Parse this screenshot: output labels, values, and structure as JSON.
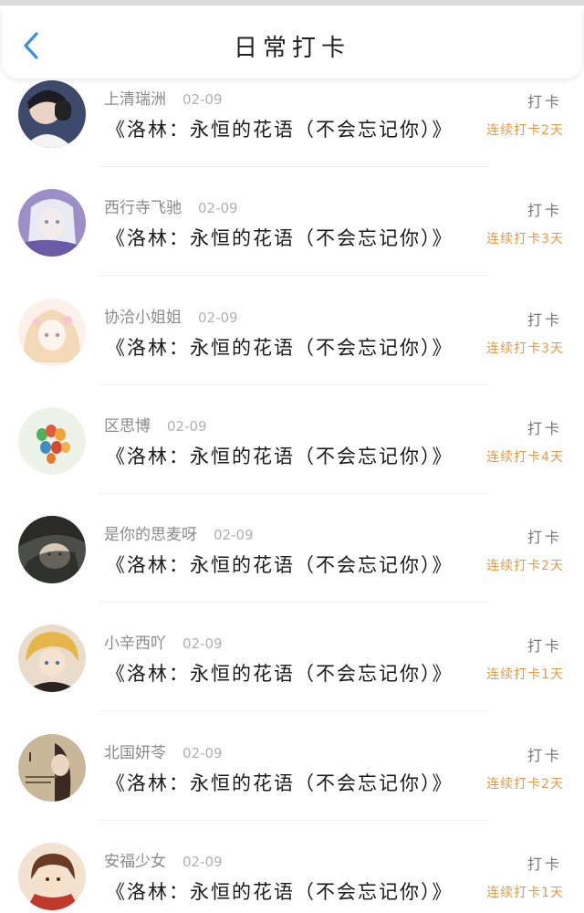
{
  "header": {
    "title": "日常打卡",
    "back_icon": "chevron-left-icon",
    "accent": "#3a8ee6"
  },
  "colors": {
    "streak": "#e29a4a",
    "meta": "#8a8a8a"
  },
  "entries": [
    {
      "user": "上清瑞洲",
      "date": "02-09",
      "song": "《洛林：永恒的花语（不会忘记你）》",
      "action": "打卡",
      "streak": "连续打卡2天"
    },
    {
      "user": "西行寺飞驰",
      "date": "02-09",
      "song": "《洛林：永恒的花语（不会忘记你）》",
      "action": "打卡",
      "streak": "连续打卡3天"
    },
    {
      "user": "协洽小姐姐",
      "date": "02-09",
      "song": "《洛林：永恒的花语（不会忘记你）》",
      "action": "打卡",
      "streak": "连续打卡3天"
    },
    {
      "user": "区思博",
      "date": "02-09",
      "song": "《洛林：永恒的花语（不会忘记你）》",
      "action": "打卡",
      "streak": "连续打卡4天"
    },
    {
      "user": "是你的思麦呀",
      "date": "02-09",
      "song": "《洛林：永恒的花语（不会忘记你）》",
      "action": "打卡",
      "streak": "连续打卡2天"
    },
    {
      "user": "小辛西吖",
      "date": "02-09",
      "song": "《洛林：永恒的花语（不会忘记你）》",
      "action": "打卡",
      "streak": "连续打卡1天"
    },
    {
      "user": "北国妍苓",
      "date": "02-09",
      "song": "《洛林：永恒的花语（不会忘记你）》",
      "action": "打卡",
      "streak": "连续打卡2天"
    },
    {
      "user": "安福少女",
      "date": "02-09",
      "song": "《洛林：永恒的花语（不会忘记你）》",
      "action": "打卡",
      "streak": "连续打卡1天"
    }
  ]
}
